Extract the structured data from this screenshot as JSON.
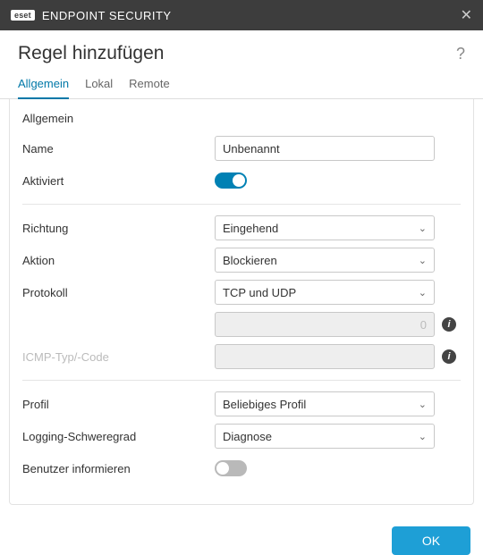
{
  "titlebar": {
    "brand_badge": "eset",
    "brand_text": "ENDPOINT SECURITY"
  },
  "header": {
    "title": "Regel hinzufügen"
  },
  "tabs": {
    "general": "Allgemein",
    "local": "Lokal",
    "remote": "Remote"
  },
  "section": {
    "general": "Allgemein"
  },
  "fields": {
    "name_label": "Name",
    "activated_label": "Aktiviert",
    "direction_label": "Richtung",
    "action_label": "Aktion",
    "protocol_label": "Protokoll",
    "icmp_label": "ICMP-Typ/-Code",
    "profile_label": "Profil",
    "logging_label": "Logging-Schweregrad",
    "notify_label": "Benutzer informieren"
  },
  "values": {
    "name": "Unbenannt",
    "direction": "Eingehend",
    "action": "Blockieren",
    "protocol": "TCP und UDP",
    "disabled_num": "0",
    "profile": "Beliebiges Profil",
    "logging": "Diagnose"
  },
  "buttons": {
    "ok": "OK"
  }
}
